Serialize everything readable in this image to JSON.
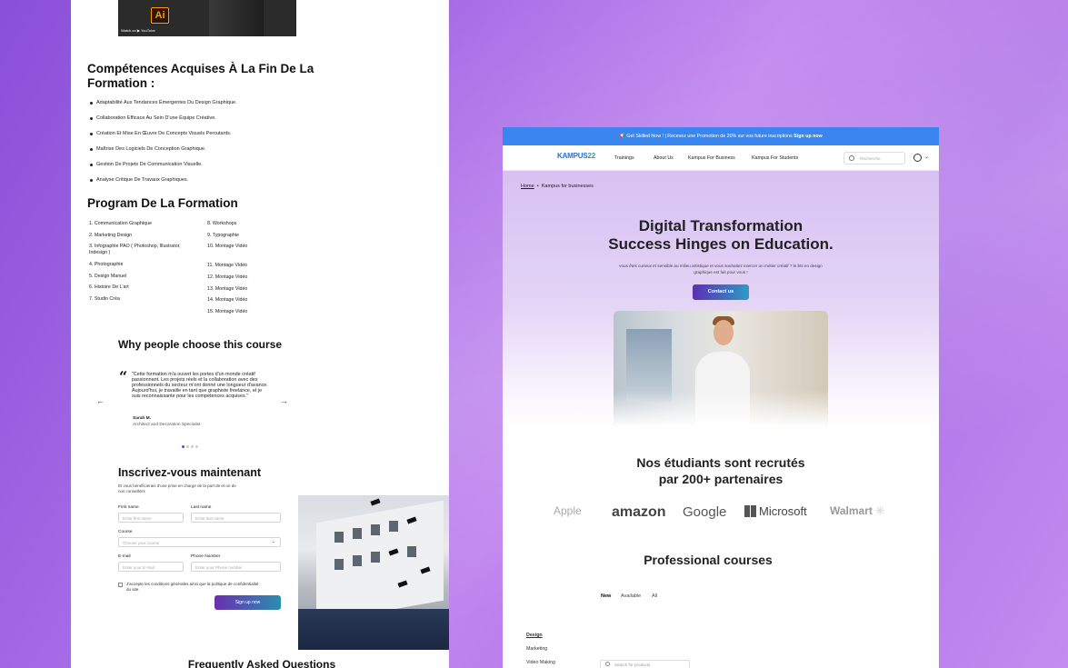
{
  "left": {
    "video_watch_label": "Watch on ▶ YouTube",
    "video_ai_label": "Ai",
    "skills_title": "Compétences Acquises À La Fin De La Formation :",
    "skills": [
      "Adaptabilité Aux Tendances Émergentes Du Design Graphique.",
      "Collaboration Efficace Au Sein D'une Équipe Créative.",
      "Création Et Mise En Œuvre De Concepts Visuels Percutants.",
      "Maîtrise Des Logiciels De Conception Graphique.",
      "Gestion De Projets De Communication Visuelle.",
      "Analyse Critique De Travaux Graphiques."
    ],
    "program_title": "Program De La Formation",
    "program_col1": [
      "1. Communication Graphique",
      "2. Marketing Design",
      "3. Infographie PAO ( Photoshop, Illustrator, Indesign )",
      "4. Photographie",
      "5. Design Manuel",
      "6. Histoire De L'art",
      "7. Studio Créa"
    ],
    "program_col2": [
      "8. Workshops",
      "9. Typographie",
      "10. Montage Vidéo",
      "11. Montage Vidéo",
      "12. Montage Vidéo",
      "13. Montage Vidéo",
      "14. Montage Vidéo",
      "15. Montage Vidéo"
    ],
    "why_title": "Why people choose this course",
    "testimonial": {
      "quote": "\"Cette formation m'a ouvert les portes d'un monde créatif passionnant. Les projets réels et la collaboration avec des professionnels du secteur m'ont donné une longueur d'avance. Aujourd'hui, je travaille en tant que graphiste freelance, et je suis reconnaissante pour les compétences acquises.\"",
      "name": "Sarah M.",
      "role": "Architect and Decoration Specialist"
    },
    "prev_arrow": "←",
    "next_arrow": "→",
    "signup": {
      "title": "Inscrivez-vous maintenant",
      "subtitle": "Et vous bénéficierais d'une prise en charge de la part de et un de nos conseillers",
      "first_name_label": "First name",
      "first_name_placeholder": "Enter first name",
      "last_name_label": "Last name",
      "last_name_placeholder": "Enter last name",
      "course_label": "Course",
      "course_placeholder": "Choose your course",
      "email_label": "E-mail",
      "email_placeholder": "Enter your E-mail",
      "phone_label": "Phone Number",
      "phone_placeholder": "Enter your Phone number",
      "agree_text": "J'accepte les conditions générales ainsi que la politique de confidentialité du site.",
      "button": "Sign up now"
    },
    "faq_title": "Frequently Asked Questions"
  },
  "right": {
    "promo_text": "Get Skilled Now ! | Recevez une Promotion de 20% sur vos future inscriptions ",
    "promo_link": "Sign up now",
    "logo_text_a": "KAMPUS",
    "logo_text_b": "22",
    "nav": [
      "Trainings",
      "About Us",
      "Kampus For Business",
      "Kampus For Students"
    ],
    "search_placeholder": "Recherche",
    "breadcrumb_home": "Home",
    "breadcrumb_sep": "•",
    "breadcrumb_current": "Kampus for businesses",
    "hero_title_1": "Digital Transformation",
    "hero_title_2": "Success Hinges on Education.",
    "hero_subtitle": "vous êtes curieux et sensible au milieu artistique et vous souhaitez exercer un métier créatif ? le bts en design graphique est fait pour vous !",
    "contact_button": "Contact us",
    "partners_title_1": "Nos étudiants sont recrutés",
    "partners_title_2": "par 200+ partenaires",
    "partner_logos": [
      "Apple",
      "amazon",
      "Google",
      "Microsoft",
      "Walmart"
    ],
    "courses_title": "Professional courses",
    "tabs": [
      "New",
      "Available",
      "All"
    ],
    "categories": [
      "Design",
      "Marketing",
      "Video Making"
    ],
    "product_search_placeholder": "Search for products"
  },
  "colors": {
    "promo_bar": "#3a86f0",
    "button_gradient_start": "#5a2fb5",
    "button_gradient_end": "#2e9bc4",
    "background_purple": "#a66ae6"
  }
}
